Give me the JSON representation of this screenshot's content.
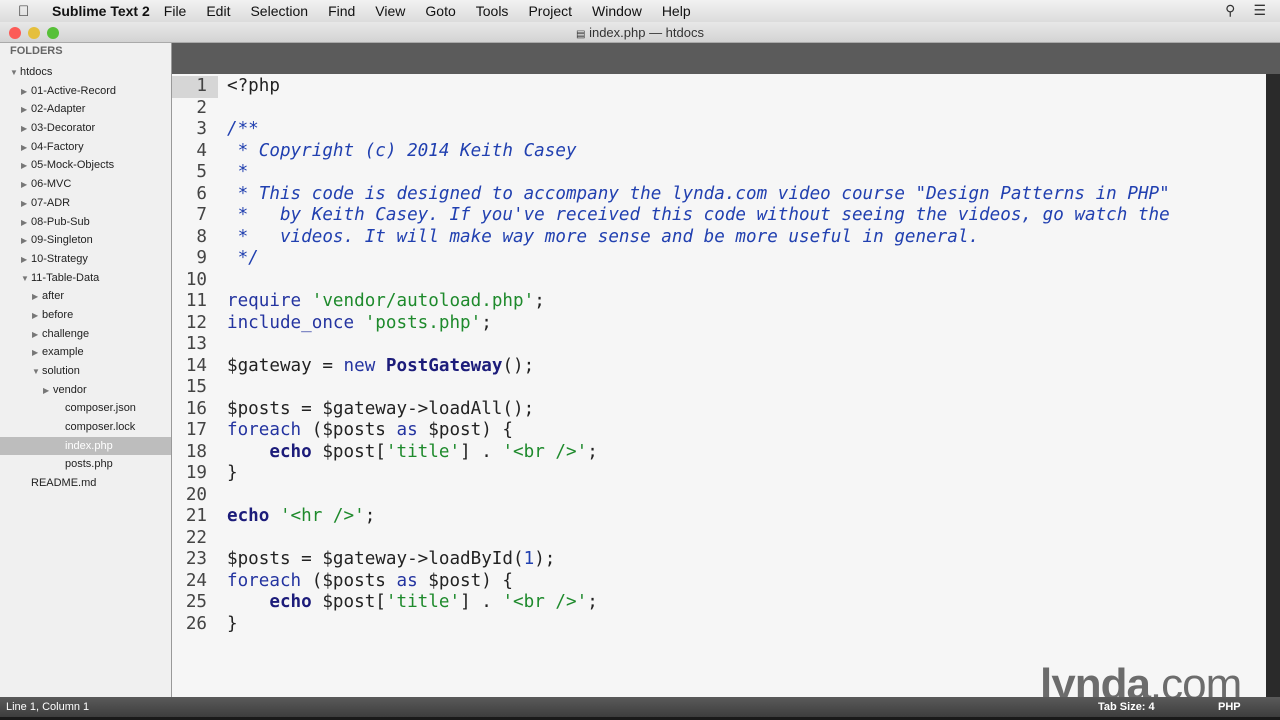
{
  "menubar": {
    "app": "Sublime Text 2",
    "items": [
      "File",
      "Edit",
      "Selection",
      "Find",
      "View",
      "Goto",
      "Tools",
      "Project",
      "Window",
      "Help"
    ]
  },
  "window": {
    "title": "index.php — htdocs"
  },
  "sidebar": {
    "header": "FOLDERS",
    "nodes": [
      {
        "label": "htdocs",
        "depth": 0,
        "state": "open"
      },
      {
        "label": "01-Active-Record",
        "depth": 1,
        "state": "closed"
      },
      {
        "label": "02-Adapter",
        "depth": 1,
        "state": "closed"
      },
      {
        "label": "03-Decorator",
        "depth": 1,
        "state": "closed"
      },
      {
        "label": "04-Factory",
        "depth": 1,
        "state": "closed"
      },
      {
        "label": "05-Mock-Objects",
        "depth": 1,
        "state": "closed"
      },
      {
        "label": "06-MVC",
        "depth": 1,
        "state": "closed"
      },
      {
        "label": "07-ADR",
        "depth": 1,
        "state": "closed"
      },
      {
        "label": "08-Pub-Sub",
        "depth": 1,
        "state": "closed"
      },
      {
        "label": "09-Singleton",
        "depth": 1,
        "state": "closed"
      },
      {
        "label": "10-Strategy",
        "depth": 1,
        "state": "closed"
      },
      {
        "label": "11-Table-Data",
        "depth": 1,
        "state": "open"
      },
      {
        "label": "after",
        "depth": 2,
        "state": "closed"
      },
      {
        "label": "before",
        "depth": 2,
        "state": "closed"
      },
      {
        "label": "challenge",
        "depth": 2,
        "state": "closed"
      },
      {
        "label": "example",
        "depth": 2,
        "state": "closed"
      },
      {
        "label": "solution",
        "depth": 2,
        "state": "open"
      },
      {
        "label": "vendor",
        "depth": 3,
        "state": "closed"
      },
      {
        "label": "composer.json",
        "depth": 3,
        "state": "file"
      },
      {
        "label": "composer.lock",
        "depth": 3,
        "state": "file"
      },
      {
        "label": "index.php",
        "depth": 3,
        "state": "file",
        "selected": true
      },
      {
        "label": "posts.php",
        "depth": 3,
        "state": "file"
      },
      {
        "label": "README.md",
        "depth": 1,
        "state": "file"
      }
    ]
  },
  "editor": {
    "lines": [
      [
        [
          "<?php",
          "pl"
        ]
      ],
      [],
      [
        [
          "/**",
          "cm"
        ]
      ],
      [
        [
          " * Copyright (c) 2014 Keith Casey",
          "cm"
        ]
      ],
      [
        [
          " *",
          "cm"
        ]
      ],
      [
        [
          " * This code is designed to accompany the lynda.com video course \"Design Patterns in PHP\"",
          "cm"
        ]
      ],
      [
        [
          " *   by Keith Casey. If you've received this code without seeing the videos, go watch the",
          "cm"
        ]
      ],
      [
        [
          " *   videos. It will make way more sense and be more useful in general.",
          "cm"
        ]
      ],
      [
        [
          " */",
          "cm"
        ]
      ],
      [],
      [
        [
          "require",
          "kw"
        ],
        [
          " ",
          "pl"
        ],
        [
          "'vendor/autoload.php'",
          "str"
        ],
        [
          ";",
          "pl"
        ]
      ],
      [
        [
          "include_once",
          "kw"
        ],
        [
          " ",
          "pl"
        ],
        [
          "'posts.php'",
          "str"
        ],
        [
          ";",
          "pl"
        ]
      ],
      [],
      [
        [
          "$gateway = ",
          "pl"
        ],
        [
          "new",
          "kw"
        ],
        [
          " ",
          "pl"
        ],
        [
          "PostGateway",
          "kwb"
        ],
        [
          "();",
          "pl"
        ]
      ],
      [],
      [
        [
          "$posts = $gateway->loadAll();",
          "pl"
        ]
      ],
      [
        [
          "foreach",
          "kw"
        ],
        [
          " ($posts ",
          "pl"
        ],
        [
          "as",
          "kw"
        ],
        [
          " $post) {",
          "pl"
        ]
      ],
      [
        [
          "    ",
          "pl"
        ],
        [
          "echo",
          "kwb"
        ],
        [
          " $post[",
          "pl"
        ],
        [
          "'title'",
          "str"
        ],
        [
          "] . ",
          "pl"
        ],
        [
          "'<br />'",
          "str"
        ],
        [
          ";",
          "pl"
        ]
      ],
      [
        [
          "}",
          "pl"
        ]
      ],
      [],
      [
        [
          "echo",
          "kwb"
        ],
        [
          " ",
          "pl"
        ],
        [
          "'<hr />'",
          "str"
        ],
        [
          ";",
          "pl"
        ]
      ],
      [],
      [
        [
          "$posts = $gateway->loadById(",
          "pl"
        ],
        [
          "1",
          "num"
        ],
        [
          ");",
          "pl"
        ]
      ],
      [
        [
          "foreach",
          "kw"
        ],
        [
          " ($posts ",
          "pl"
        ],
        [
          "as",
          "kw"
        ],
        [
          " $post) {",
          "pl"
        ]
      ],
      [
        [
          "    ",
          "pl"
        ],
        [
          "echo",
          "kwb"
        ],
        [
          " $post[",
          "pl"
        ],
        [
          "'title'",
          "str"
        ],
        [
          "] . ",
          "pl"
        ],
        [
          "'<br />'",
          "str"
        ],
        [
          ";",
          "pl"
        ]
      ],
      [
        [
          "}",
          "pl"
        ]
      ]
    ]
  },
  "statusbar": {
    "position": "Line 1, Column 1",
    "tab_size": "Tab Size: 4",
    "syntax": "PHP"
  },
  "watermark": "lynda.com"
}
